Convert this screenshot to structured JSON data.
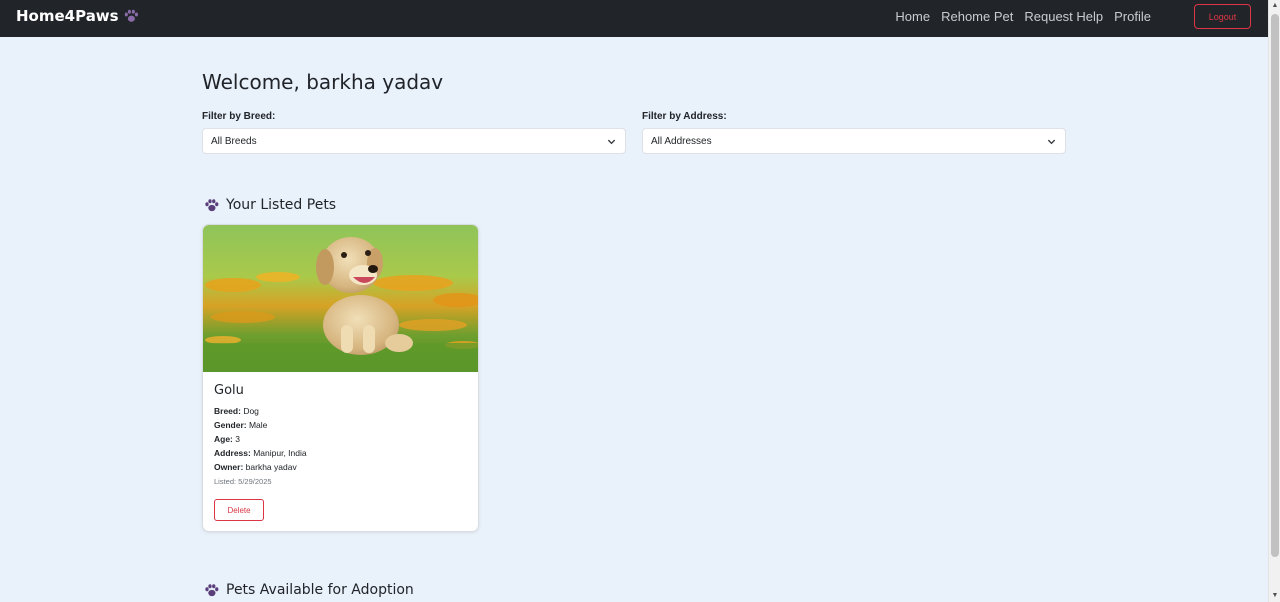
{
  "navbar": {
    "brand": "Home4Paws",
    "brand_icon": "paw-icon",
    "links": [
      "Home",
      "Rehome Pet",
      "Request Help",
      "Profile"
    ],
    "logout_label": "Logout"
  },
  "welcome": "Welcome, barkha yadav",
  "filters": {
    "breed": {
      "label": "Filter by Breed:",
      "value": "All Breeds"
    },
    "address": {
      "label": "Filter by Address:",
      "value": "All Addresses"
    }
  },
  "sections": {
    "listed_title": "Your Listed Pets",
    "adoption_title": "Pets Available for Adoption"
  },
  "pet": {
    "name": "Golu",
    "image": "golden-retriever-puppy-photo",
    "breed_label": "Breed:",
    "breed": "Dog",
    "gender_label": "Gender:",
    "gender": "Male",
    "age_label": "Age:",
    "age": "3",
    "address_label": "Address:",
    "address": "Manipur, India",
    "owner_label": "Owner:",
    "owner": "barkha yadav",
    "listed": "Listed: 5/29/2025",
    "delete_label": "Delete"
  },
  "colors": {
    "navbar_bg": "#212529",
    "page_bg": "#e9f1fb",
    "danger": "#dc3545",
    "paw": "#5b3f7a"
  }
}
